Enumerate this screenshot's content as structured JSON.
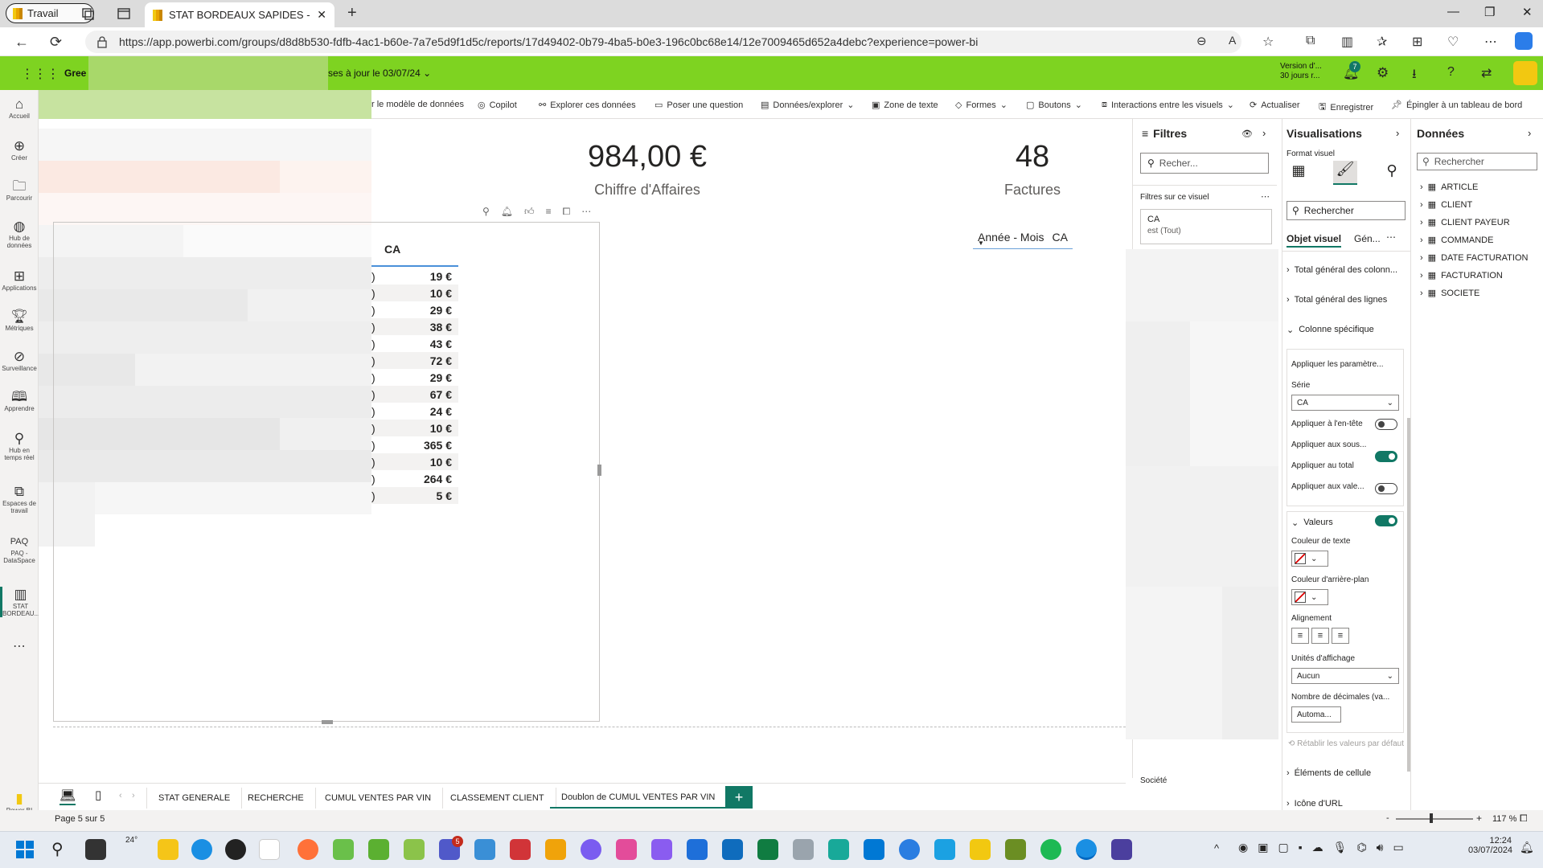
{
  "browser": {
    "profile_label": "Travail",
    "active_tab_title": "STAT BORDEAUX SAPIDES - Pow",
    "url": "https://app.powerbi.com/groups/d8d8b530-fdfb-4ac1-b60e-7a7e5d9f1d5c/reports/17d49402-0b79-4ba5-b0e3-196c0bc68e14/12e7009465d652a4debc?experience=power-bi"
  },
  "header": {
    "workspace_label": "Gree",
    "update_label": "ses à jour le 03/07/24",
    "version_line1": "Version d'...",
    "version_line2": "30 jours r...",
    "notif_count": "7"
  },
  "toolbar": {
    "items": [
      "r le modèle de données",
      "Copilot",
      "Explorer ces données",
      "Poser une question",
      "Données/explorer",
      "Zone de texte",
      "Formes",
      "Boutons",
      "Interactions entre les visuels",
      "Actualiser",
      "Enregistrer",
      "Épingler à un tableau de bord"
    ]
  },
  "leftnav": {
    "items": [
      "Accueil",
      "Créer",
      "Parcourir",
      "Hub de données",
      "Applications",
      "Métriques",
      "Surveillance",
      "Apprendre",
      "Hub en temps réel",
      "Espaces de travail",
      "PAQ - DataSpace",
      "STAT BORDEAU..."
    ],
    "powerbi_label": "Power BI"
  },
  "report": {
    "kpi1_value": "984,00 €",
    "kpi1_label": "Chiffre d'Affaires",
    "kpi2_value": "48",
    "kpi2_label": "Factures",
    "slicer_label": "Année - Mois",
    "slicer_value": "CA",
    "table_header": "CA",
    "table_values": [
      "19 €",
      "10 €",
      "29 €",
      "38 €",
      "43 €",
      "72 €",
      "29 €",
      "67 €",
      "24 €",
      "10 €",
      "365 €",
      "10 €",
      "264 €",
      "5 €"
    ]
  },
  "filters": {
    "title": "Filtres",
    "search_placeholder": "Recher...",
    "section_label": "Filtres sur ce visuel",
    "filter_field": "CA",
    "filter_value": "est (Tout)",
    "bottom_label": "Société"
  },
  "viz": {
    "title": "Visualisations",
    "format_label": "Format visuel",
    "search_placeholder": "Rechercher",
    "tab_visual": "Objet visuel",
    "tab_general": "Gén...",
    "section_total_cols": "Total général des colonn...",
    "section_total_rows": "Total général des lignes",
    "section_specific": "Colonne spécifique",
    "apply_settings": "Appliquer les paramètre...",
    "serie_label": "Série",
    "serie_value": "CA",
    "opt_header": "Appliquer à l'en-tête",
    "opt_sub": "Appliquer aux sous...",
    "opt_total": "Appliquer au total",
    "opt_values": "Appliquer aux vale...",
    "values_section": "Valeurs",
    "text_color": "Couleur de texte",
    "bg_color": "Couleur d'arrière-plan",
    "alignment": "Alignement",
    "units_label": "Unités d'affichage",
    "units_value": "Aucun",
    "decimals_label": "Nombre de décimales (va...",
    "decimals_value": "Automa...",
    "reset_label": "Rétablir les valeurs par défaut",
    "cell_elements": "Éléments de cellule",
    "url_icon": "Icône d'URL"
  },
  "data_pane": {
    "title": "Données",
    "search_placeholder": "Rechercher",
    "tables": [
      "ARTICLE",
      "CLIENT",
      "CLIENT PAYEUR",
      "COMMANDE",
      "DATE FACTURATION",
      "FACTURATION",
      "SOCIETE"
    ]
  },
  "pages": {
    "tabs": [
      "STAT GENERALE",
      "RECHERCHE",
      "CUMUL VENTES PAR VIN",
      "CLASSEMENT CLIENT",
      "Doublon de CUMUL VENTES PAR VIN"
    ],
    "add_label": "+",
    "page_indicator": "Page 5 sur 5",
    "zoom": "117 %"
  },
  "taskbar": {
    "weather": "24°",
    "teams_badge": "5",
    "time": "12:24",
    "date": "03/07/2024"
  },
  "colors": {
    "brand_green": "#7ed321",
    "accent_teal": "#117865",
    "powerbi_yellow": "#f2c811"
  }
}
